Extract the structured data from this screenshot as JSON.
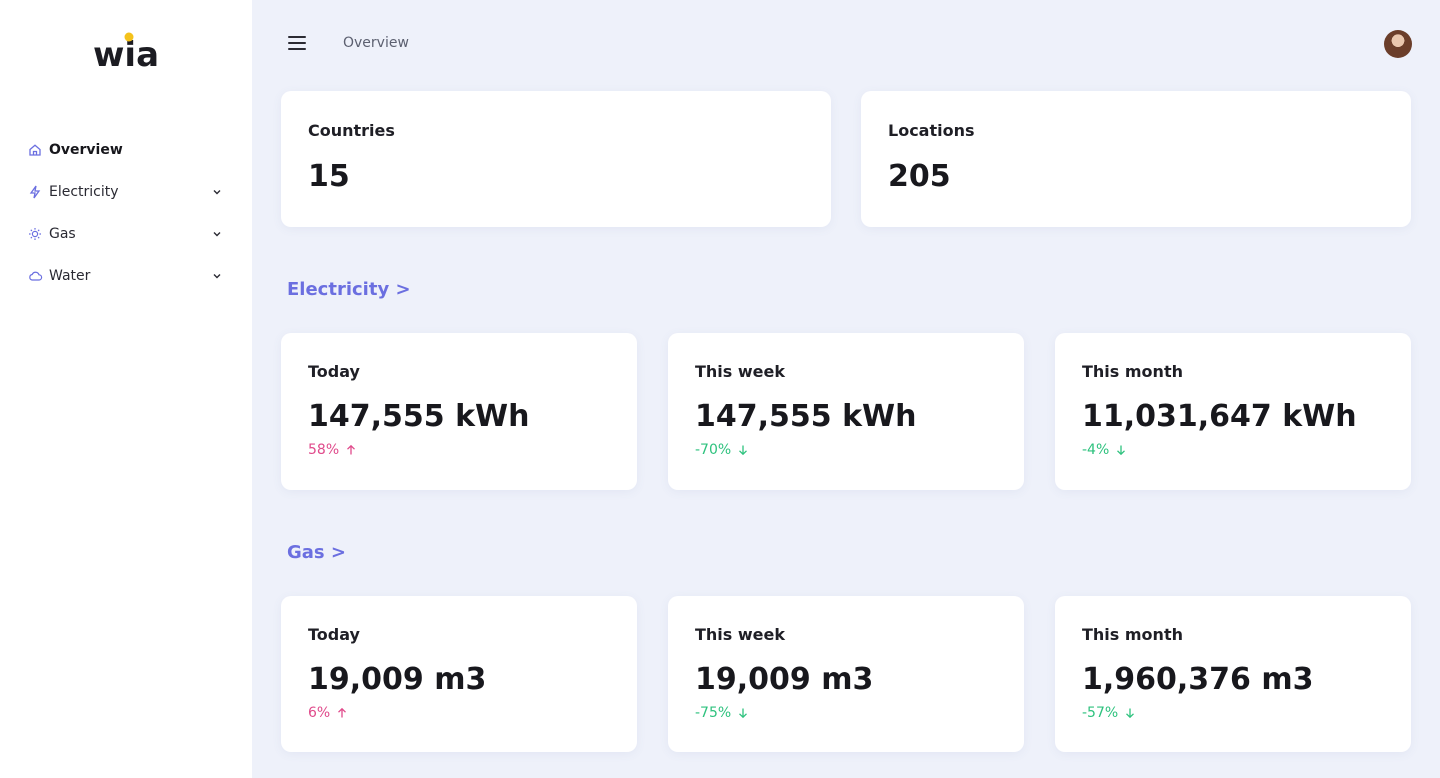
{
  "brand": {
    "name": "wia",
    "dot_color": "#f4c21c"
  },
  "sidebar": {
    "items": [
      {
        "label": "Overview",
        "icon": "home-icon",
        "active": true
      },
      {
        "label": "Electricity",
        "icon": "lightning-icon",
        "active": false
      },
      {
        "label": "Gas",
        "icon": "sun-icon",
        "active": false
      },
      {
        "label": "Water",
        "icon": "cloud-icon",
        "active": false
      }
    ]
  },
  "header": {
    "breadcrumb": "Overview",
    "menu_icon": "hamburger-icon",
    "avatar": "user-avatar"
  },
  "summary": {
    "countries": {
      "label": "Countries",
      "value": "15"
    },
    "locations": {
      "label": "Locations",
      "value": "205"
    }
  },
  "electricity": {
    "title": "Electricity >",
    "cards": [
      {
        "label": "Today",
        "value": "147,555 kWh",
        "delta": "58%",
        "direction": "up"
      },
      {
        "label": "This week",
        "value": "147,555 kWh",
        "delta": "-70%",
        "direction": "down"
      },
      {
        "label": "This month",
        "value": "11,031,647 kWh",
        "delta": "-4%",
        "direction": "down"
      }
    ]
  },
  "gas": {
    "title": "Gas >",
    "cards": [
      {
        "label": "Today",
        "value": "19,009 m3",
        "delta": "6%",
        "direction": "up"
      },
      {
        "label": "This week",
        "value": "19,009 m3",
        "delta": "-75%",
        "direction": "down"
      },
      {
        "label": "This month",
        "value": "1,960,376 m3",
        "delta": "-57%",
        "direction": "down"
      }
    ]
  },
  "colors": {
    "accent": "#6b6fe0",
    "positive_up": "#e04a8b",
    "negative_down": "#2ec27e",
    "background": "#eef1fa"
  }
}
